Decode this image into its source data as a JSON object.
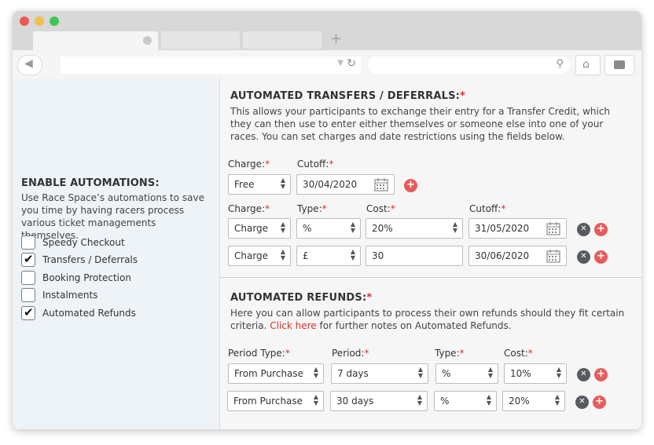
{
  "browser": {
    "new_tab_symbol": "+",
    "back_symbol": "◀",
    "reload_symbol": "↻",
    "search_symbol": "⚲",
    "home_symbol": "⌂",
    "dropdown_symbol": "▼"
  },
  "sidebar": {
    "title": "ENABLE AUTOMATIONS:",
    "description": "Use Race Space’s automations to save you time by having racers process various ticket managements themselves.",
    "options": [
      {
        "label": "Speedy Checkout",
        "checked": false
      },
      {
        "label": "Transfers / Deferrals",
        "checked": true
      },
      {
        "label": "Booking Protection",
        "checked": false
      },
      {
        "label": "Instalments",
        "checked": false
      },
      {
        "label": "Automated Refunds",
        "checked": true
      }
    ]
  },
  "transfers": {
    "title": "AUTOMATED TRANSFERS / DEFERRALS:",
    "required_mark": "*",
    "description": "This allows your participants to exchange their entry for a Transfer Credit, which they can then use to enter either themselves or someone else into one of your races. You can set charges and date restrictions using the fields below.",
    "labels": {
      "charge": "Charge:",
      "cutoff": "Cutoff:",
      "type": "Type:",
      "cost": "Cost:"
    },
    "free_row": {
      "charge": "Free",
      "cutoff": "30/04/2020"
    },
    "rows": [
      {
        "charge": "Charge",
        "type": "%",
        "cost": "20%",
        "cutoff": "31/05/2020"
      },
      {
        "charge": "Charge",
        "type": "£",
        "cost": "30",
        "cutoff": "30/06/2020"
      }
    ]
  },
  "refunds": {
    "title": "AUTOMATED REFUNDS:",
    "required_mark": "*",
    "description_pre": "Here you can allow participants to process their own refunds should they fit certain criteria.",
    "link_text": "Click here",
    "description_post": " for further notes on Automated Refunds.",
    "labels": {
      "period_type": "Period Type:",
      "period": "Period:",
      "type": "Type:",
      "cost": "Cost:"
    },
    "rows": [
      {
        "period_type": "From Purchase",
        "period": "7 days",
        "type": "%",
        "cost": "10%"
      },
      {
        "period_type": "From Purchase",
        "period": "30 days",
        "type": "%",
        "cost": "20%"
      }
    ]
  },
  "icons": {
    "add": "+",
    "remove": "✕",
    "up_down": "▲▼"
  },
  "colors": {
    "accent_red": "#e95b5b",
    "required_red": "#e02d2d",
    "sidebar_bg": "#eef3f8",
    "main_bg": "#f6f6f6"
  }
}
